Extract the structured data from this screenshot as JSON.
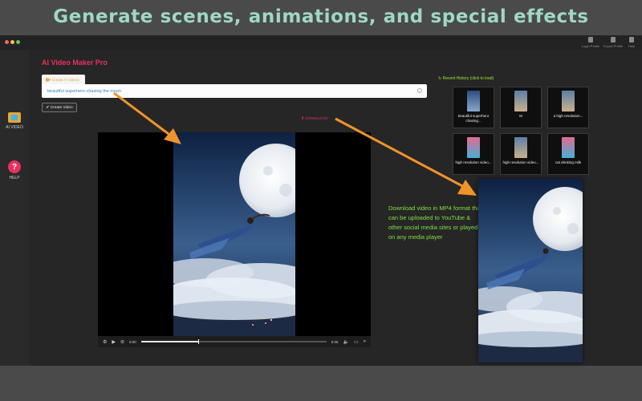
{
  "headline": "Generate scenes, animations, and special effects",
  "toolbar": {
    "login_profile": "Login Profile",
    "export_profile": "Export Profile",
    "help": "Help"
  },
  "sidebar": {
    "items": [
      {
        "label": "AI VIDEO",
        "icon": "video-icon"
      },
      {
        "label": "HELP",
        "icon": "help-icon",
        "glyph": "?"
      }
    ]
  },
  "app_title": "AI Video Maker Pro",
  "create_tab": {
    "icon": "video-camera-icon",
    "label": "Create AI Videos"
  },
  "prompt": {
    "value": "beautiful superhero chasing the moon"
  },
  "create_button": {
    "icon": "checkmark-icon",
    "label": "Create Video"
  },
  "download": {
    "icon": "download-icon",
    "label": "DOWNLOAD"
  },
  "player": {
    "current_time": "0:00",
    "duration": "0:06",
    "progress": 0.31
  },
  "history": {
    "title": "Recent History (click to load)",
    "items": [
      {
        "caption": "beautiful superhero chasing..."
      },
      {
        "caption": "M"
      },
      {
        "caption": "a high resolution..."
      },
      {
        "caption": "high resolution video..."
      },
      {
        "caption": "high resolution video..."
      },
      {
        "caption": "cat drinking milk"
      }
    ]
  },
  "caption": "Download video in MP4 format that can be uploaded to YouTube & other social media sites or played on any media player",
  "colors": {
    "accent_pink": "#e8315f",
    "headline": "#9fd8c4",
    "caption_green": "#7fe03d",
    "arrow_orange": "#f0932b"
  }
}
